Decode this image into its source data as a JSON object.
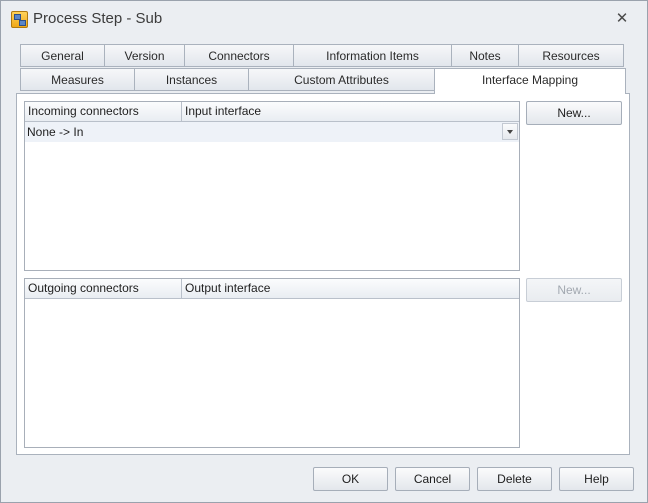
{
  "window": {
    "title": "Process Step - Sub",
    "close_glyph": "✕"
  },
  "tabs": {
    "row1": [
      "General",
      "Version",
      "Connectors",
      "Information Items",
      "Notes",
      "Resources"
    ],
    "row2": [
      "Measures",
      "Instances",
      "Custom Attributes",
      "Interface Mapping"
    ],
    "active": "Interface Mapping"
  },
  "incoming": {
    "col1": "Incoming connectors",
    "col2": "Input interface",
    "rows": [
      "None -> In"
    ],
    "new_label": "New..."
  },
  "outgoing": {
    "col1": "Outgoing connectors",
    "col2": "Output interface",
    "new_label": "New..."
  },
  "footer": {
    "ok": "OK",
    "cancel": "Cancel",
    "delete": "Delete",
    "help": "Help"
  }
}
